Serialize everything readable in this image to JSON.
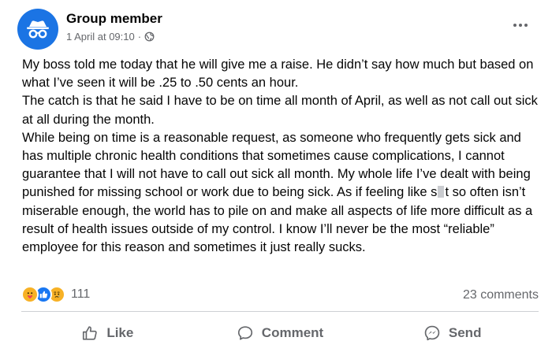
{
  "post": {
    "author": "Group member",
    "timestamp": "1 April at 09:10",
    "separator": "·",
    "privacy_icon": "globe-icon",
    "paragraphs": [
      "My boss told me today that he will give me a raise. He didn’t say how much but based on what I’ve seen it will be .25 to .50 cents an hour.",
      "The catch is that he said I have to be on time all month of April, as well as not call out sick at all during the month."
    ],
    "p3_before": "While being on time is a reasonable request, as someone who frequently gets sick and has multiple chronic health conditions that sometimes cause complications, I cannot guarantee that I will not have to call out sick all month. My whole life I’ve dealt with being punished for missing school or work due to being sick. As if feeling like s",
    "p3_after": "t so often isn’t miserable enough, the world has to pile on and make all aspects of life more difficult as a result of health issues outside of my control. I know I’ll never be the most “reliable” employee for this reason and sometimes it just really sucks."
  },
  "reactions": {
    "types": [
      "care",
      "like",
      "sad"
    ],
    "count": "111"
  },
  "comments_count": "23 comments",
  "actions": {
    "like": "Like",
    "comment": "Comment",
    "send": "Send"
  },
  "colors": {
    "accent": "#1877f2",
    "muted_text": "#65676b",
    "reaction_yellow": "#f7b125"
  }
}
